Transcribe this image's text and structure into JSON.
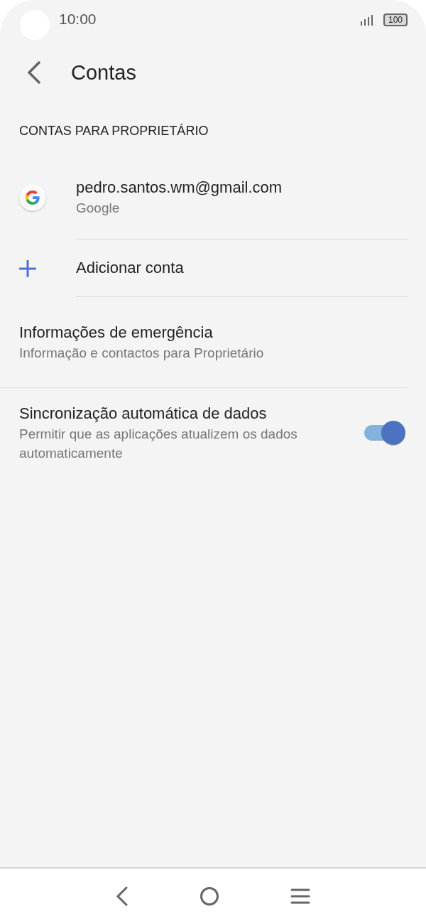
{
  "status_bar": {
    "time": "10:00",
    "battery": "100"
  },
  "header": {
    "title": "Contas"
  },
  "section_title": "CONTAS PARA PROPRIETÁRIO",
  "accounts": [
    {
      "kind": "account",
      "title": "pedro.santos.wm@gmail.com",
      "subtitle": "Google"
    },
    {
      "kind": "add",
      "title": "Adicionar conta"
    }
  ],
  "settings": [
    {
      "kind": "link",
      "title": "Informações de emergência",
      "subtitle": "Informação e contactos para Proprietário"
    },
    {
      "kind": "toggle",
      "title": "Sincronização automática de dados",
      "subtitle": "Permitir que as aplicações atualizem os dados automaticamente",
      "on": true
    }
  ]
}
